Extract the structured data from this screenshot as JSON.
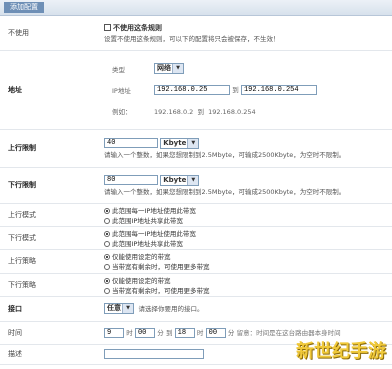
{
  "tab": "添加配置",
  "disable": {
    "label": "不使用",
    "checkbox_label": "不使用这条规则",
    "hint": "设置不使用这条规则，可以下的配置将只会被保存，不生效！"
  },
  "address": {
    "label": "地址",
    "type_label": "类型",
    "type_value": "网络",
    "ip_label": "IP地址",
    "ip_from": "192.168.0.25",
    "to_label": "到",
    "ip_to": "192.168.0.254",
    "example_label": "例如：",
    "example_from": "192.168.0.2",
    "example_to": "192.168.0.254"
  },
  "up_limit": {
    "label": "上行限制",
    "value": "40",
    "unit": "Kbyte",
    "hint": "请输入一个整数，如果您想限制到2.5Mbyte，可输成2500Kbyte，为空时不限制。"
  },
  "down_limit": {
    "label": "下行限制",
    "value": "80",
    "unit": "Kbyte",
    "hint": "请输入一个整数，如果您想限制到2.5Mbyte，可输成2500Kbyte，为空时不限制。"
  },
  "up_mode": {
    "label": "上行模式",
    "opt1": "此范围每一IP地址使用此带宽",
    "opt2": "此范围IP地址共享此带宽"
  },
  "down_mode": {
    "label": "下行模式",
    "opt1": "此范围每一IP地址使用此带宽",
    "opt2": "此范围IP地址共享此带宽"
  },
  "up_policy": {
    "label": "上行策略",
    "opt1": "仅能使用设定的带宽",
    "opt2": "当带宽有剩余时，可使用更多带宽"
  },
  "down_policy": {
    "label": "下行策略",
    "opt1": "仅能使用设定的带宽",
    "opt2": "当带宽有剩余时，可使用更多带宽"
  },
  "interface": {
    "label": "接口",
    "value": "任意",
    "hint": "请选择你要用的接口。"
  },
  "time": {
    "label": "时间",
    "h1": "9",
    "h_label": "时",
    "m1": "00",
    "m_label": "分",
    "to": "到",
    "h2": "18",
    "m2": "00",
    "note": "留意：时间是在这台路由器本身时间"
  },
  "description": {
    "label": "描述",
    "value": ""
  },
  "watermark": "新世纪手游"
}
